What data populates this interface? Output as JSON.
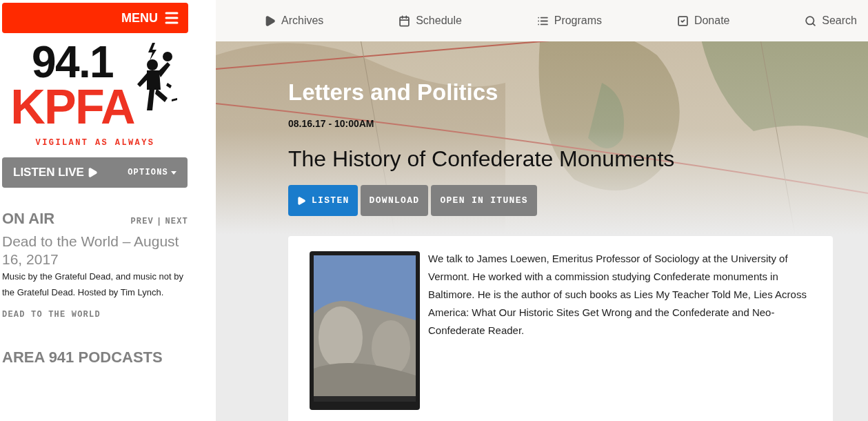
{
  "menu_button": {
    "label": "MENU"
  },
  "logo": {
    "number": "94.1",
    "name": "KPFA",
    "tagline": "VIGILANT AS ALWAYS"
  },
  "listen_live": {
    "label": "LISTEN LIVE",
    "options": "OPTIONS"
  },
  "on_air": {
    "heading": "ON AIR",
    "prev": "PREV",
    "separator": "|",
    "next": "NEXT",
    "title": "Dead to the World – August 16, 2017",
    "description": "Music by the Grateful Dead, and music not by the Grateful Dead. Hosted by Tim Lynch.",
    "program_link": "DEAD TO THE WORLD"
  },
  "podcasts": {
    "heading": "AREA 941 PODCASTS"
  },
  "nav": [
    {
      "kind": "play",
      "label": "Archives"
    },
    {
      "kind": "calendar",
      "label": "Schedule"
    },
    {
      "kind": "list",
      "label": "Programs"
    },
    {
      "kind": "check",
      "label": "Donate"
    },
    {
      "kind": "search",
      "label": "Search"
    }
  ],
  "episode": {
    "program": "Letters and Politics",
    "date": "08.16.17 - 10:00AM",
    "title": "The History of Confederate Monuments",
    "buttons": [
      {
        "kind": "listen",
        "label": "LISTEN"
      },
      {
        "kind": "plain",
        "label": "DOWNLOAD"
      },
      {
        "kind": "plain",
        "label": "OPEN IN ITUNES"
      }
    ],
    "description": "We talk to James Loewen, Emeritus Professor of Sociology at the University of Vermont. He worked with a commission studying Confederate monuments in Baltimore. He is the author of such books as Lies My Teacher Told Me, Lies Across America: What Our Historic Sites Get Wrong and the Confederate and Neo-Confederate Reader."
  }
}
